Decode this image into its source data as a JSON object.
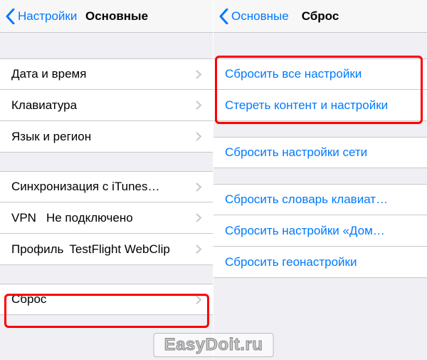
{
  "left": {
    "back_label": "Настройки",
    "title": "Основные",
    "group1": [
      {
        "label": "Дата и время"
      },
      {
        "label": "Клавиатура"
      },
      {
        "label": "Язык и регион"
      }
    ],
    "group2": [
      {
        "label": "Синхронизация с iTunes…",
        "value": ""
      },
      {
        "label": "VPN",
        "value": "Не подключено"
      },
      {
        "label": "Профиль",
        "value": "TestFlight WebClip"
      }
    ],
    "group3": [
      {
        "label": "Сброс"
      }
    ]
  },
  "right": {
    "back_label": "Основные",
    "title": "Сброс",
    "group1": [
      "Сбросить все настройки",
      "Стереть контент и настройки"
    ],
    "group2": [
      "Сбросить настройки сети"
    ],
    "group3": [
      "Сбросить словарь клавиат…",
      "Сбросить настройки «Дом…",
      "Сбросить геонастройки"
    ]
  },
  "watermark": "EasyDoit.ru"
}
